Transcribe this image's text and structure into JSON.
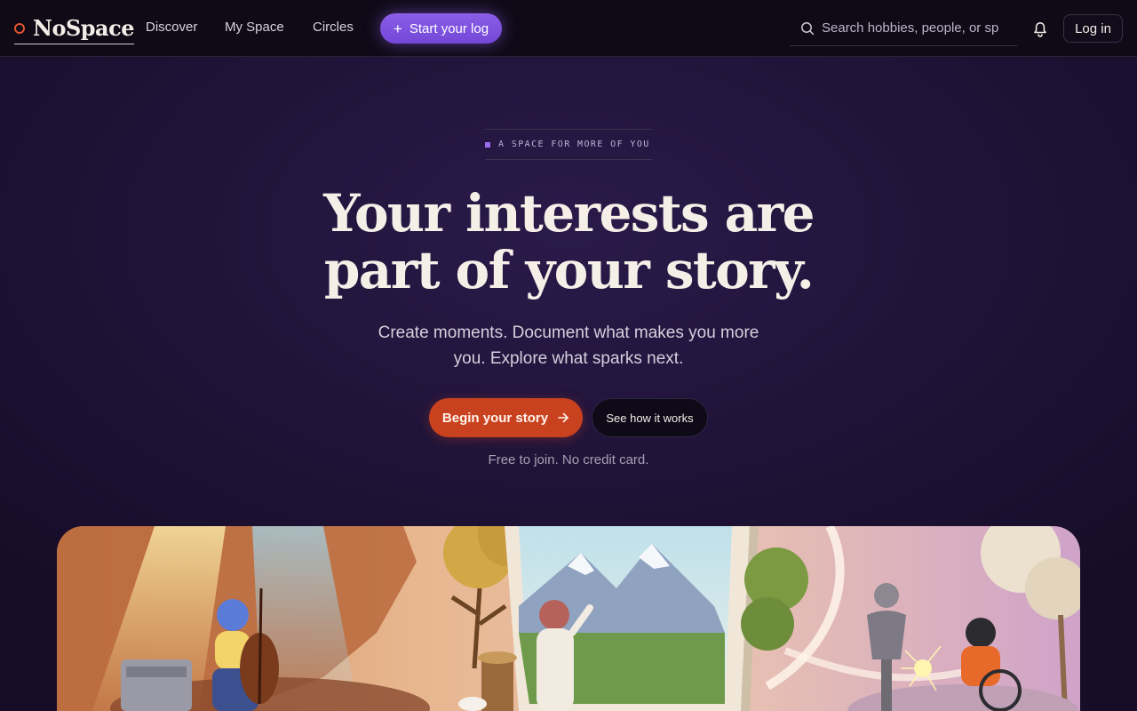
{
  "nav": {
    "brand": "NoSpace",
    "links": [
      {
        "label": "Discover"
      },
      {
        "label": "My Space"
      },
      {
        "label": "Circles"
      }
    ],
    "start_label": "Start your log",
    "search_placeholder": "Search hobbies, people, or sp",
    "login_label": "Log in"
  },
  "hero": {
    "eyebrow": "A SPACE FOR MORE OF YOU",
    "headline_line1": "Your interests are",
    "headline_line2": "part of your story.",
    "subhead_line1": "Create moments. Document what makes you more",
    "subhead_line2": "you. Explore what sparks next.",
    "cta_primary": "Begin your story",
    "cta_secondary": "See how it works",
    "note": "Free to join. No credit card."
  },
  "icons": {
    "brand": "ring-logo-icon",
    "start": "plus-icon",
    "search": "search-icon",
    "bell": "bell-icon",
    "cta": "arrow-right-icon"
  },
  "colors": {
    "accent_purple": "#7e52df",
    "accent_orange": "#c9421f",
    "background": "#1e1234",
    "nav_bg": "#0f0a16",
    "text": "#f3ece6"
  }
}
